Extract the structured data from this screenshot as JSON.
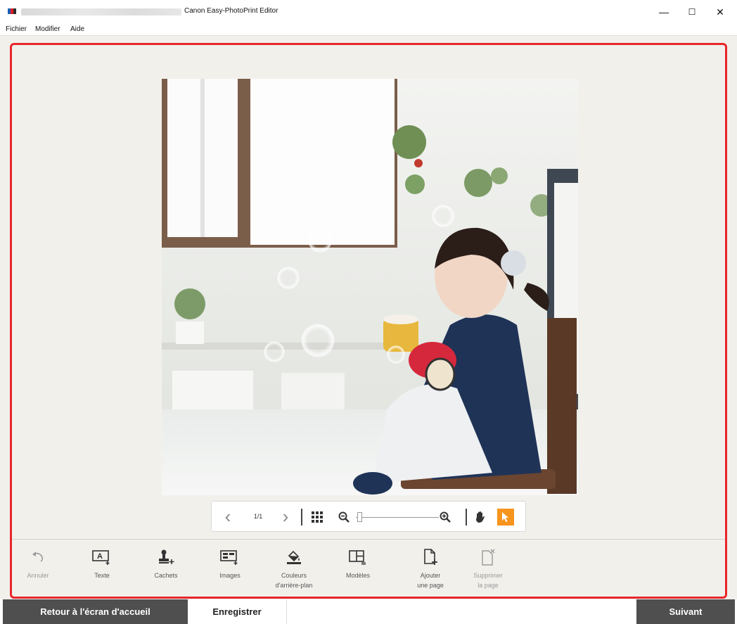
{
  "window": {
    "title": "Canon Easy-PhotoPrint Editor",
    "minimize_glyph": "—",
    "maximize_glyph": "☐",
    "close_glyph": "✕"
  },
  "menu": {
    "items": [
      {
        "label": "Fichier"
      },
      {
        "label": "Modifier"
      },
      {
        "label": "Aide"
      }
    ]
  },
  "canvas": {
    "image_icon": "photo-child-with-cups",
    "highlight_color": "#e8262a"
  },
  "navigation": {
    "prev_glyph": "‹",
    "page_indicator": "1/1",
    "next_glyph": "›",
    "zoom_level": 0.0,
    "hand_icon": "hand-icon",
    "pointer_icon": "pointer-icon",
    "active_color": "#f7941d"
  },
  "toolbar": {
    "items": [
      {
        "label": "Annuler",
        "icon": "undo-icon",
        "enabled": false
      },
      {
        "label": "Texte",
        "icon": "text-icon",
        "enabled": true
      },
      {
        "label": "Cachets",
        "icon": "stamp-icon",
        "enabled": true
      },
      {
        "label": "Images",
        "icon": "image-icon",
        "enabled": true
      },
      {
        "label_line1": "Couleurs",
        "label_line2": "d'arrière-plan",
        "icon": "background-color-icon",
        "enabled": true
      },
      {
        "label": "Modèles",
        "icon": "layout-icon",
        "enabled": true
      },
      {
        "label_line1": "Ajouter",
        "label_line2": "une page",
        "icon": "add-page-icon",
        "enabled": true
      },
      {
        "label_line1": "Supprimer",
        "label_line2": "la page",
        "icon": "delete-page-icon",
        "enabled": false
      }
    ]
  },
  "footer": {
    "home_label": "Retour à l'écran d'accueil",
    "save_label": "Enregistrer",
    "next_label": "Suivant"
  }
}
